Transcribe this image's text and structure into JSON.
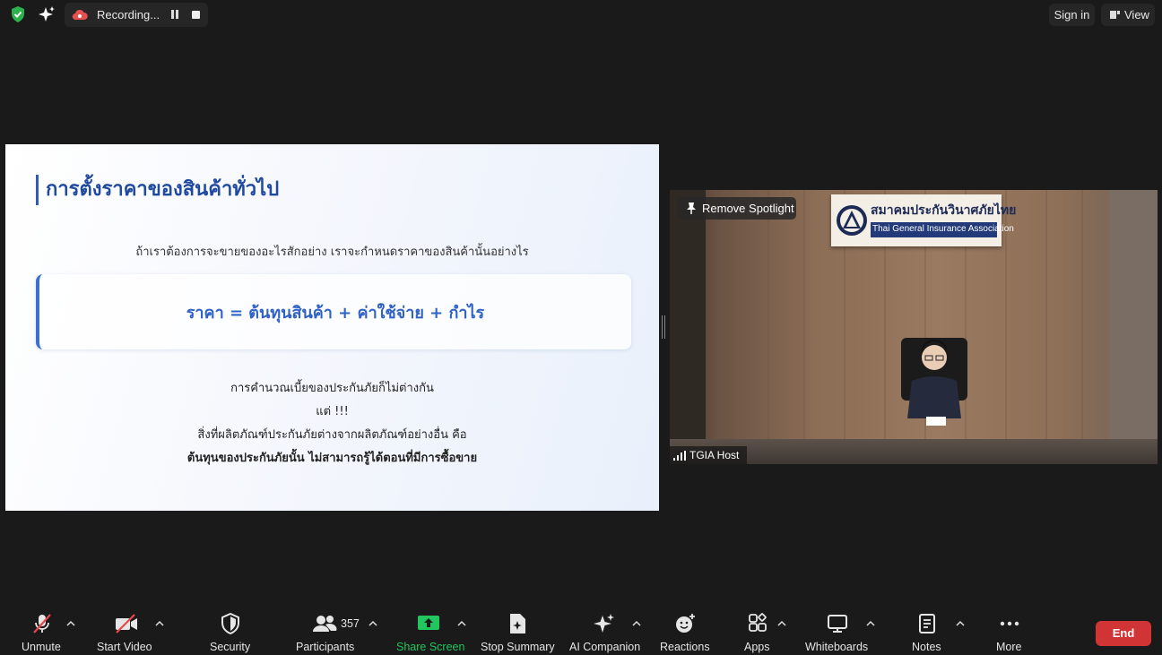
{
  "topbar": {
    "recording_label": "Recording...",
    "sign_in_label": "Sign in",
    "view_label": "View",
    "colors": {
      "security_shield": "#2bb24c",
      "recording_cloud": "#e8504f"
    }
  },
  "slide": {
    "title": "การตั้งราคาของสินค้าทั่วไป",
    "question": "ถ้าเราต้องการจะขายของอะไรสักอย่าง เราจะกำหนดราคาของสินค้านั้นอย่างไร",
    "formula": "ราคา = ต้นทุนสินค้า + ค่าใช้จ่าย + กำไร",
    "line1": "การคำนวณเบี้ยของประกันภัยก็ไม่ต่างกัน",
    "line2": "แต่ !!!",
    "line3": "สิ่งที่ผลิตภัณฑ์ประกันภัยต่างจากผลิตภัณฑ์อย่างอื่น คือ",
    "line4": "ต้นทุนของประกันภัยนั้น ไม่สามารถรู้ได้ตอนที่มีการซื้อขาย"
  },
  "video": {
    "spotlight_label": "Remove Spotlight",
    "participant_name": "TGIA Host",
    "logo_thai": "สมาคมประกันวินาศภัยไทย",
    "logo_english": "Thai General Insurance Association"
  },
  "toolbar": {
    "unmute": "Unmute",
    "start_video": "Start Video",
    "security": "Security",
    "participants": "Participants",
    "participants_count": "357",
    "share_screen": "Share Screen",
    "stop_summary": "Stop Summary",
    "ai_companion": "AI Companion",
    "reactions": "Reactions",
    "apps": "Apps",
    "whiteboards": "Whiteboards",
    "notes": "Notes",
    "more": "More",
    "end": "End",
    "colors": {
      "share_screen": "#22c55e",
      "end": "#d13434",
      "muted": "#e5484d"
    }
  }
}
